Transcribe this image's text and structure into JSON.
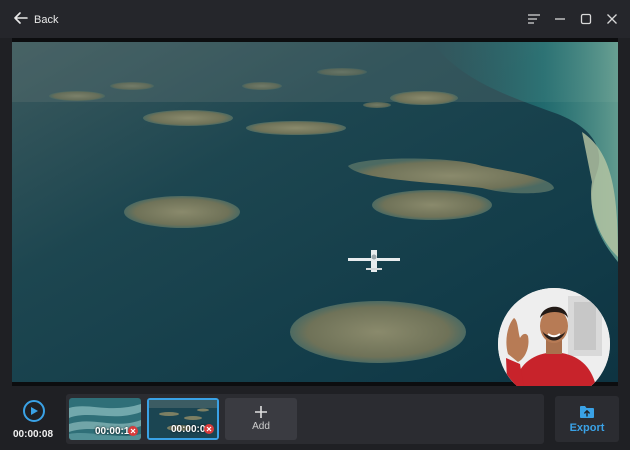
{
  "window": {
    "back_label": "Back",
    "controls": [
      "menu-icon",
      "minimize-icon",
      "maximize-icon",
      "close-icon"
    ]
  },
  "player": {
    "current_time": "00:00:08",
    "play_icon": "play-icon"
  },
  "timeline": {
    "clips": [
      {
        "duration": "00:00:15",
        "thumbnail": "ocean-waves",
        "selected": false
      },
      {
        "duration": "00:00:08",
        "thumbnail": "islands-aerial",
        "selected": true
      }
    ],
    "add_label": "Add"
  },
  "export": {
    "label": "Export",
    "icon": "folder-export-icon"
  },
  "colors": {
    "accent": "#3aa2e6",
    "background": "#1f2024",
    "remove": "#d73b3b"
  }
}
